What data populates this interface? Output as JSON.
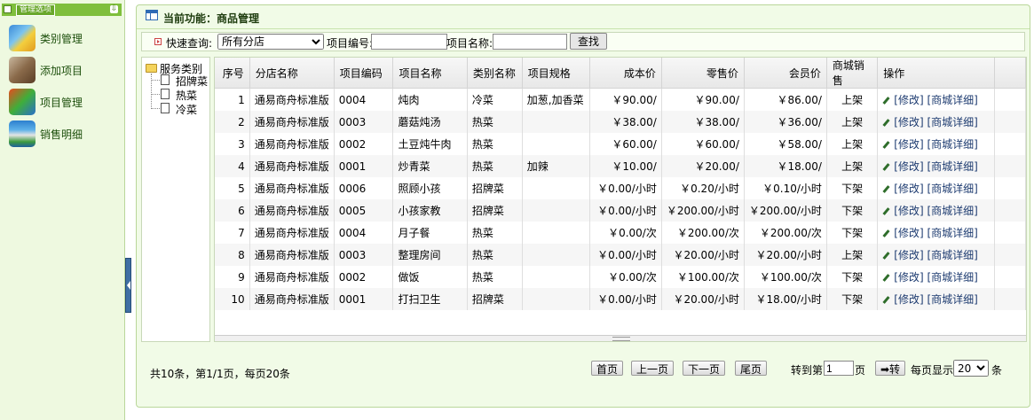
{
  "sidebar": {
    "header_title": "管理选项",
    "items": [
      {
        "label": "类别管理",
        "icon": "category-icon"
      },
      {
        "label": "添加项目",
        "icon": "add-item-icon"
      },
      {
        "label": "项目管理",
        "icon": "item-manage-icon"
      },
      {
        "label": "销售明细",
        "icon": "sales-detail-icon"
      }
    ]
  },
  "panel": {
    "current_function_label": "当前功能：",
    "current_function": "商品管理"
  },
  "search": {
    "quick_query_label": "快速查询:",
    "branch_selected": "所有分店",
    "item_code_label": "项目编号:",
    "item_code_value": "",
    "item_name_label": "项目名称:",
    "item_name_value": "",
    "search_button": "查找"
  },
  "tree": {
    "root": "服务类别",
    "children": [
      "招牌菜",
      "热菜",
      "冷菜"
    ]
  },
  "table": {
    "columns": [
      "序号",
      "分店名称",
      "项目编码",
      "项目名称",
      "类别名称",
      "项目规格",
      "成本价",
      "零售价",
      "会员价",
      "商城销售",
      "操作"
    ],
    "rows": [
      [
        "1",
        "通易商舟标准版",
        "0004",
        "炖肉",
        "冷菜",
        "加葱,加香菜",
        "￥90.00/",
        "￥90.00/",
        "￥86.00/",
        "上架"
      ],
      [
        "2",
        "通易商舟标准版",
        "0003",
        "蘑菇炖汤",
        "热菜",
        "",
        "￥38.00/",
        "￥38.00/",
        "￥36.00/",
        "上架"
      ],
      [
        "3",
        "通易商舟标准版",
        "0002",
        "土豆炖牛肉",
        "热菜",
        "",
        "￥60.00/",
        "￥60.00/",
        "￥58.00/",
        "上架"
      ],
      [
        "4",
        "通易商舟标准版",
        "0001",
        "炒青菜",
        "热菜",
        "加辣",
        "￥10.00/",
        "￥20.00/",
        "￥18.00/",
        "上架"
      ],
      [
        "5",
        "通易商舟标准版",
        "0006",
        "照顾小孩",
        "招牌菜",
        "",
        "￥0.00/小时",
        "￥0.20/小时",
        "￥0.10/小时",
        "下架"
      ],
      [
        "6",
        "通易商舟标准版",
        "0005",
        "小孩家教",
        "招牌菜",
        "",
        "￥0.00/小时",
        "￥200.00/小时",
        "￥200.00/小时",
        "下架"
      ],
      [
        "7",
        "通易商舟标准版",
        "0004",
        "月子餐",
        "热菜",
        "",
        "￥0.00/次",
        "￥200.00/次",
        "￥200.00/次",
        "下架"
      ],
      [
        "8",
        "通易商舟标准版",
        "0003",
        "整理房间",
        "热菜",
        "",
        "￥0.00/小时",
        "￥20.00/小时",
        "￥20.00/小时",
        "上架"
      ],
      [
        "9",
        "通易商舟标准版",
        "0002",
        "做饭",
        "热菜",
        "",
        "￥0.00/次",
        "￥100.00/次",
        "￥100.00/次",
        "下架"
      ],
      [
        "10",
        "通易商舟标准版",
        "0001",
        "打扫卫生",
        "招牌菜",
        "",
        "￥0.00/小时",
        "￥20.00/小时",
        "￥18.00/小时",
        "下架"
      ]
    ],
    "action_modify": "[修改]",
    "action_detail": "[商城详细]"
  },
  "pager": {
    "info": "共10条，第1/1页，每页20条",
    "first": "首页",
    "prev": "上一页",
    "next": "下一页",
    "last": "尾页",
    "goto_prefix": "转到第",
    "goto_value": "1",
    "goto_suffix": "页",
    "go_button": "➡转",
    "perpage_label": "每页显示",
    "perpage_value": "20",
    "perpage_suffix": "条"
  },
  "colors": {
    "sidebar_bg": "#eef9e0",
    "panel_bg": "#f1fbe7",
    "accent_green": "#7fbf3c",
    "handle_blue": "#3f6fa4"
  }
}
